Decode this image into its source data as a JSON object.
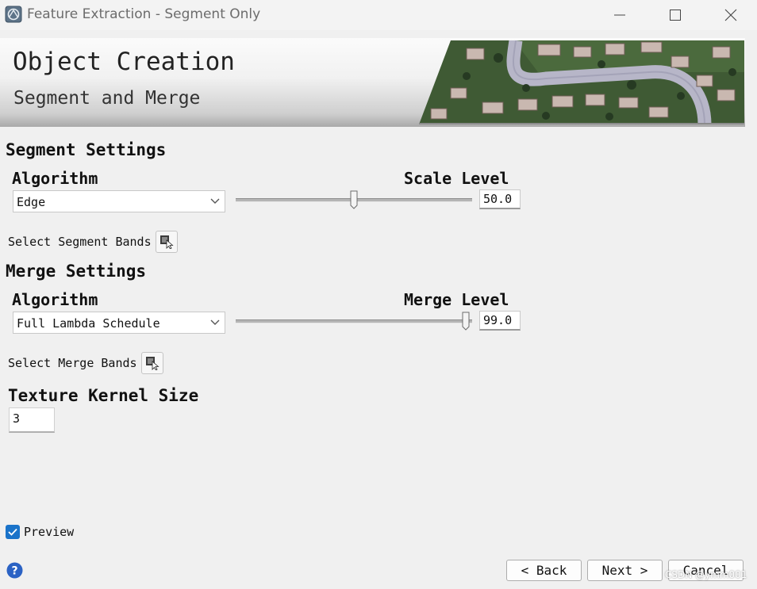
{
  "window": {
    "title": "Feature Extraction - Segment Only",
    "controls": [
      "minimize-icon",
      "maximize-icon",
      "close-icon"
    ]
  },
  "banner": {
    "title": "Object Creation",
    "subtitle": "Segment and Merge",
    "image": "aerial-neighborhood-image"
  },
  "segment": {
    "section_title": "Segment Settings",
    "algorithm_label": "Algorithm",
    "algorithm_value": "Edge",
    "level_label": "Scale Level",
    "level_value": "50.0",
    "level_fraction": 0.5,
    "bands_label": "Select Segment Bands"
  },
  "merge": {
    "section_title": "Merge Settings",
    "algorithm_label": "Algorithm",
    "algorithm_value": "Full Lambda Schedule",
    "level_label": "Merge Level",
    "level_value": "99.0",
    "level_fraction": 0.99,
    "bands_label": "Select Merge Bands"
  },
  "texture": {
    "label": "Texture Kernel Size",
    "value": "3"
  },
  "preview": {
    "label": "Preview",
    "checked": true
  },
  "buttons": {
    "back": "< Back",
    "next": "Next >",
    "cancel": "Cancel"
  },
  "watermark": "CSDN @ymm001",
  "colors": {
    "accent": "#1a73c9",
    "help": "#2b62c4"
  }
}
